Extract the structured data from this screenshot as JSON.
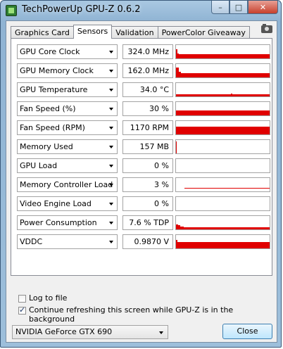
{
  "window": {
    "title": "TechPowerUp GPU-Z 0.6.2",
    "icon": "gpu-z-app-icon",
    "controls": {
      "minimize": "–",
      "maximize": "□",
      "close": "✕"
    }
  },
  "tabs": [
    {
      "label": "Graphics Card",
      "active": false
    },
    {
      "label": "Sensors",
      "active": true
    },
    {
      "label": "Validation",
      "active": false
    },
    {
      "label": "PowerColor Giveaway",
      "active": false
    }
  ],
  "screenshot_icon": "camera-icon",
  "sensors": [
    {
      "label": "GPU Core Clock",
      "value": "324.0 MHz"
    },
    {
      "label": "GPU Memory Clock",
      "value": "162.0 MHz"
    },
    {
      "label": "GPU Temperature",
      "value": "34.0 °C"
    },
    {
      "label": "Fan Speed (%)",
      "value": "30 %"
    },
    {
      "label": "Fan Speed (RPM)",
      "value": "1170 RPM"
    },
    {
      "label": "Memory Used",
      "value": "157 MB"
    },
    {
      "label": "GPU Load",
      "value": "0 %"
    },
    {
      "label": "Memory Controller Load",
      "value": "3 %"
    },
    {
      "label": "Video Engine Load",
      "value": "0 %"
    },
    {
      "label": "Power Consumption",
      "value": "7.6 % TDP"
    },
    {
      "label": "VDDC",
      "value": "0.9870 V"
    }
  ],
  "graph_color": "#e00000",
  "options": {
    "log_to_file": {
      "label": "Log to file",
      "checked": false
    },
    "continue_refresh": {
      "label": "Continue refreshing this screen while GPU-Z is in the background",
      "checked": true
    }
  },
  "gpu_select": {
    "value": "NVIDIA GeForce GTX 690"
  },
  "close_button": "Close"
}
